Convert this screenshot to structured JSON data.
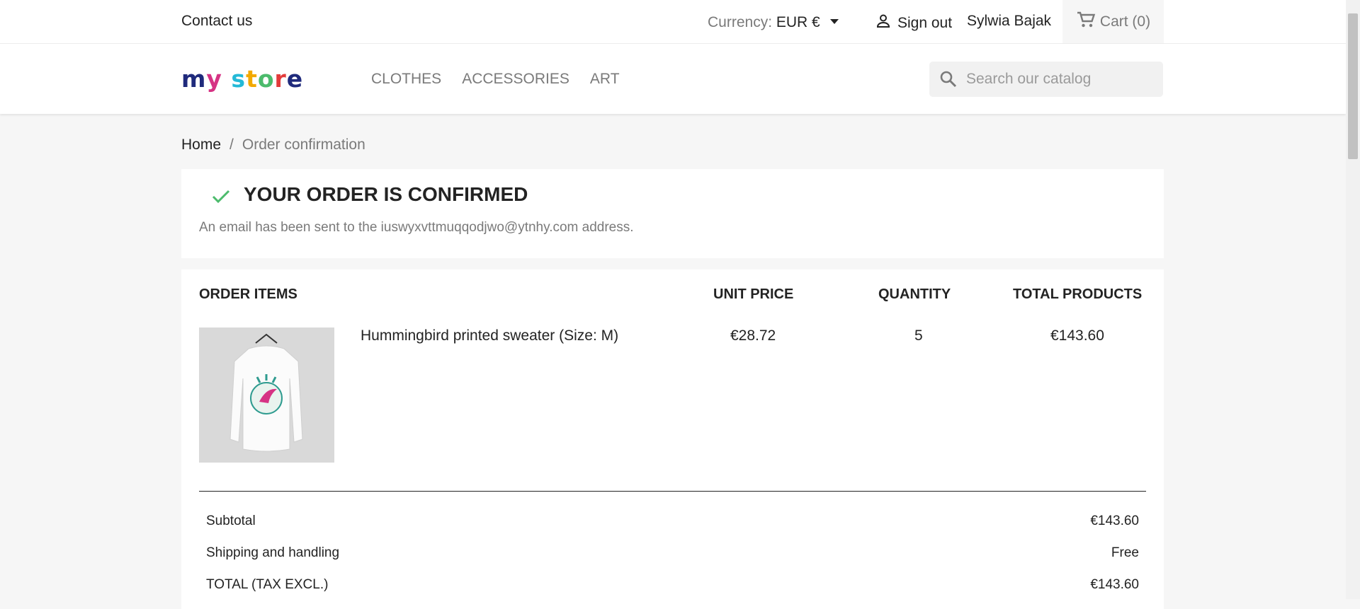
{
  "topbar": {
    "contact": "Contact us",
    "currency_label": "Currency:",
    "currency_value": "EUR €",
    "sign_out": "Sign out",
    "user_name": "Sylwia Bajak",
    "cart": "Cart (0)"
  },
  "header": {
    "logo_parts": [
      "m",
      "y",
      " ",
      "s",
      "t",
      "o",
      "r",
      "e"
    ],
    "nav": [
      "CLOTHES",
      "ACCESSORIES",
      "ART"
    ],
    "search_placeholder": "Search our catalog"
  },
  "breadcrumb": {
    "home": "Home",
    "separator": "/",
    "current": "Order confirmation"
  },
  "confirmation": {
    "title": "YOUR ORDER IS CONFIRMED",
    "message": "An email has been sent to the iuswyxvttmuqqodjwo@ytnhy.com address."
  },
  "order": {
    "headers": {
      "items": "ORDER ITEMS",
      "unit_price": "UNIT PRICE",
      "quantity": "QUANTITY",
      "total_products": "TOTAL PRODUCTS"
    },
    "item": {
      "name": "Hummingbird printed sweater (Size: M)",
      "unit_price": "€28.72",
      "quantity": "5",
      "total": "€143.60"
    },
    "summary": {
      "subtotal_label": "Subtotal",
      "subtotal_value": "€143.60",
      "shipping_label": "Shipping and handling",
      "shipping_value": "Free",
      "total_label": "TOTAL (TAX EXCL.)",
      "total_value": "€143.60"
    }
  },
  "colors": {
    "accent": "#24b9d7",
    "check": "#4cbb6c",
    "logo": [
      "#1f2a7c",
      "#d63384",
      "#ffffff",
      "#24b9d7",
      "#f2a900",
      "#4cbb6c",
      "#e33b3b",
      "#1f2a7c"
    ]
  }
}
